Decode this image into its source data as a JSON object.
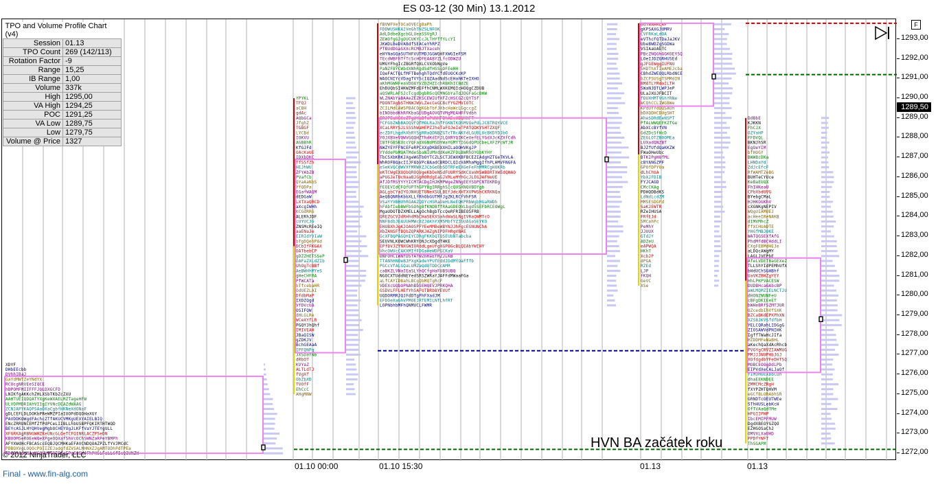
{
  "title": "ES 03-12 (30 Min)  13.1.2012",
  "info_table": {
    "header": "TPO and Volume Profile Chart (v4)",
    "rows": [
      {
        "label": "Session",
        "value": "01.13"
      },
      {
        "label": "TPO Count",
        "value": "269 (142/113)"
      },
      {
        "label": "Rotation Factor",
        "value": "-9"
      },
      {
        "label": "Range",
        "value": "15,25"
      },
      {
        "label": "IB Range",
        "value": "1,00"
      },
      {
        "label": "Volume",
        "value": "337k"
      },
      {
        "label": "High",
        "value": "1295,00"
      },
      {
        "label": "VA High",
        "value": "1294,25"
      },
      {
        "label": "POC",
        "value": "1291,25"
      },
      {
        "label": "VA Low",
        "value": "1289,75"
      },
      {
        "label": "Low",
        "value": "1279,75"
      },
      {
        "label": "Volume @ Price",
        "value": "1327"
      }
    ]
  },
  "copyright": "© 2012 NinjaTrader, LLC",
  "footer": "Final - www.fin-alg.com",
  "annotation": "HVN BA začátek roku",
  "f_badge": "F",
  "current_price": "1289,50",
  "colors": {
    "value_area": "#ee82ee",
    "volume_profile": "#c8c8f0",
    "tpo_red": "#cc0000",
    "tpo_green": "#008000",
    "navy_line": "#000080",
    "green_line": "#006400",
    "red_line": "#cc0000",
    "grid": "#b0b0b0"
  },
  "chart_data": {
    "type": "tpo-profile",
    "price_axis": {
      "ticks": [
        "1272,00",
        "1273,00",
        "1274,00",
        "1275,00",
        "1276,00",
        "1277,00",
        "1278,00",
        "1279,00",
        "1280,00",
        "1281,00",
        "1282,00",
        "1283,00",
        "1284,00",
        "1285,00",
        "1286,00",
        "1287,00",
        "1288,00",
        "1289,00",
        "1290,00",
        "1291,00",
        "1292,00",
        "1293,00"
      ],
      "min": 1271.9,
      "max": 1293.9
    },
    "x_labels": [
      {
        "text": "01.10 00:00",
        "col": 429
      },
      {
        "text": "01.10 15:30",
        "col": 552
      },
      {
        "text": "01.13",
        "col": 932
      },
      {
        "text": "01.13",
        "col": 1088
      }
    ],
    "sessions": [
      {
        "name": "s1",
        "low": 1272.0,
        "high": 1276.5,
        "va_low": 1272.0,
        "va_high": 1275.9,
        "poc": 1272.3
      },
      {
        "name": "s2",
        "low": 1275.0,
        "high": 1290.0,
        "va_low": 1277.1,
        "va_high": 1286.9,
        "poc": 1281.8
      },
      {
        "name": "s3",
        "low": 1279.5,
        "high": 1293.8,
        "va_low": 1282.1,
        "va_high": 1289.0,
        "poc": 1286.9
      },
      {
        "name": "s4",
        "low": 1280.5,
        "high": 1293.8,
        "va_low": 1289.6,
        "va_high": 1293.8,
        "poc": 1291.1
      },
      {
        "name": "s5",
        "low": 1272.5,
        "high": 1289.0,
        "va_low": 1276.1,
        "va_high": 1281.9,
        "poc": 1278.8
      }
    ],
    "horizontal_lines": [
      {
        "price": 1277.2,
        "color": "navy",
        "from": "s3",
        "to": "s5"
      },
      {
        "price": 1272.2,
        "color": "green",
        "from": "s2",
        "to": "end"
      },
      {
        "price": 1291.2,
        "color": "green",
        "from": "s5",
        "to": "end"
      },
      {
        "price": 1293.8,
        "color": "red",
        "from": "s5",
        "to": "end"
      }
    ]
  }
}
